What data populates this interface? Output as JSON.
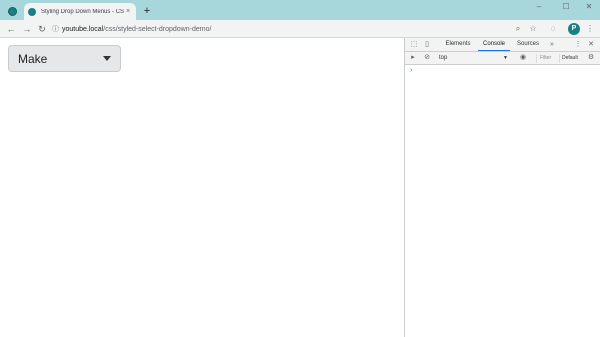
{
  "browser": {
    "tab": {
      "title": "Styling Drop Down Menus - CSS",
      "close_glyph": "×"
    },
    "new_tab_glyph": "+",
    "window_controls": {
      "minimize": "–",
      "maximize": "☐",
      "close": "✕"
    },
    "nav": {
      "back": "←",
      "forward": "→",
      "reload": "↻"
    },
    "address": {
      "host": "youtube.local",
      "path": "/css/styled-select-dropdown-demo/",
      "lock_glyph": "ⓘ"
    },
    "toolbar_icons": {
      "zoom": "⌕",
      "bookmark": "☆",
      "extensions": "◌",
      "profile_letter": "P",
      "menu": "⋮"
    },
    "accent_color": "#1a7f86",
    "tabstrip_color": "#a7d7da"
  },
  "page": {
    "select": {
      "value": "Make"
    }
  },
  "devtools": {
    "tabs": [
      "Elements",
      "Console",
      "Sources"
    ],
    "active_tab": "Console",
    "more_tabs": "»",
    "menu_glyph": "⋮",
    "close_glyph": "✕",
    "context": "top",
    "context_arrow": "▼",
    "eye_glyph": "◉",
    "filter_placeholder": "Filter",
    "levels": "Default",
    "settings_glyph": "⚙",
    "prompt": "›"
  }
}
